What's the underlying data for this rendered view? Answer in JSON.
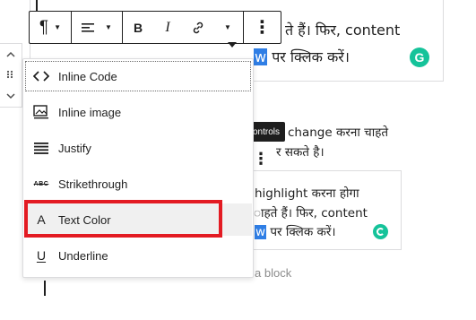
{
  "editor": {
    "top_line1": "ते हैं। फिर, content",
    "top_line2_highlight": "w",
    "top_line2_rest": "पर क्लिक करें।",
    "mid_line1": "change करना चाहते",
    "mid_line2": "र सकते है।",
    "low_line1": "highlight करना होगा",
    "low_line2": "ाहते हैं। फिर, content",
    "low_line3_highlight": "w",
    "low_line3_rest": "पर क्लिक करें।",
    "placeholder": "a block",
    "grammarly_letter": "G"
  },
  "toolbar": {
    "paragraph_icon": "¶",
    "bold_label": "B",
    "italic_label": "I",
    "more_label": "⋮"
  },
  "tooltip": {
    "text": "ontrols"
  },
  "menu": {
    "items": [
      {
        "label": "Inline Code",
        "icon": "code-icon"
      },
      {
        "label": "Inline image",
        "icon": "image-icon"
      },
      {
        "label": "Justify",
        "icon": "justify-icon"
      },
      {
        "label": "Strikethrough",
        "icon": "strikethrough-icon"
      },
      {
        "label": "Text Color",
        "icon": "text-color-icon"
      },
      {
        "label": "Underline",
        "icon": "underline-icon"
      }
    ]
  },
  "colors": {
    "highlight": "#2f7ee5",
    "grammarly": "#15c39a",
    "annotation_red": "#e31b23",
    "tooltip_bg": "#1e1e1e"
  }
}
